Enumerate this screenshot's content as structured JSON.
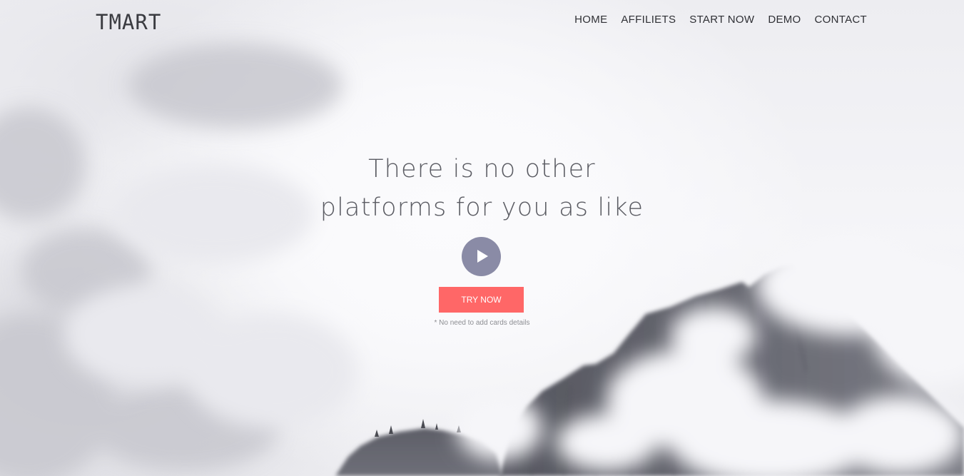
{
  "brand": {
    "name": "TMART"
  },
  "nav": {
    "items": [
      "HOME",
      "AFFILIETS",
      "START NOW",
      "DEMO",
      "CONTACT"
    ]
  },
  "hero": {
    "headline_line1": "There is no other",
    "headline_line2": "platforms for you as like",
    "play_icon": "play-icon",
    "cta_label": "TRY NOW",
    "note": "* No need to add cards details"
  },
  "colors": {
    "cta_background": "#ff6767",
    "play_button": "#8a8ba6",
    "text_dark": "#2f3035"
  }
}
